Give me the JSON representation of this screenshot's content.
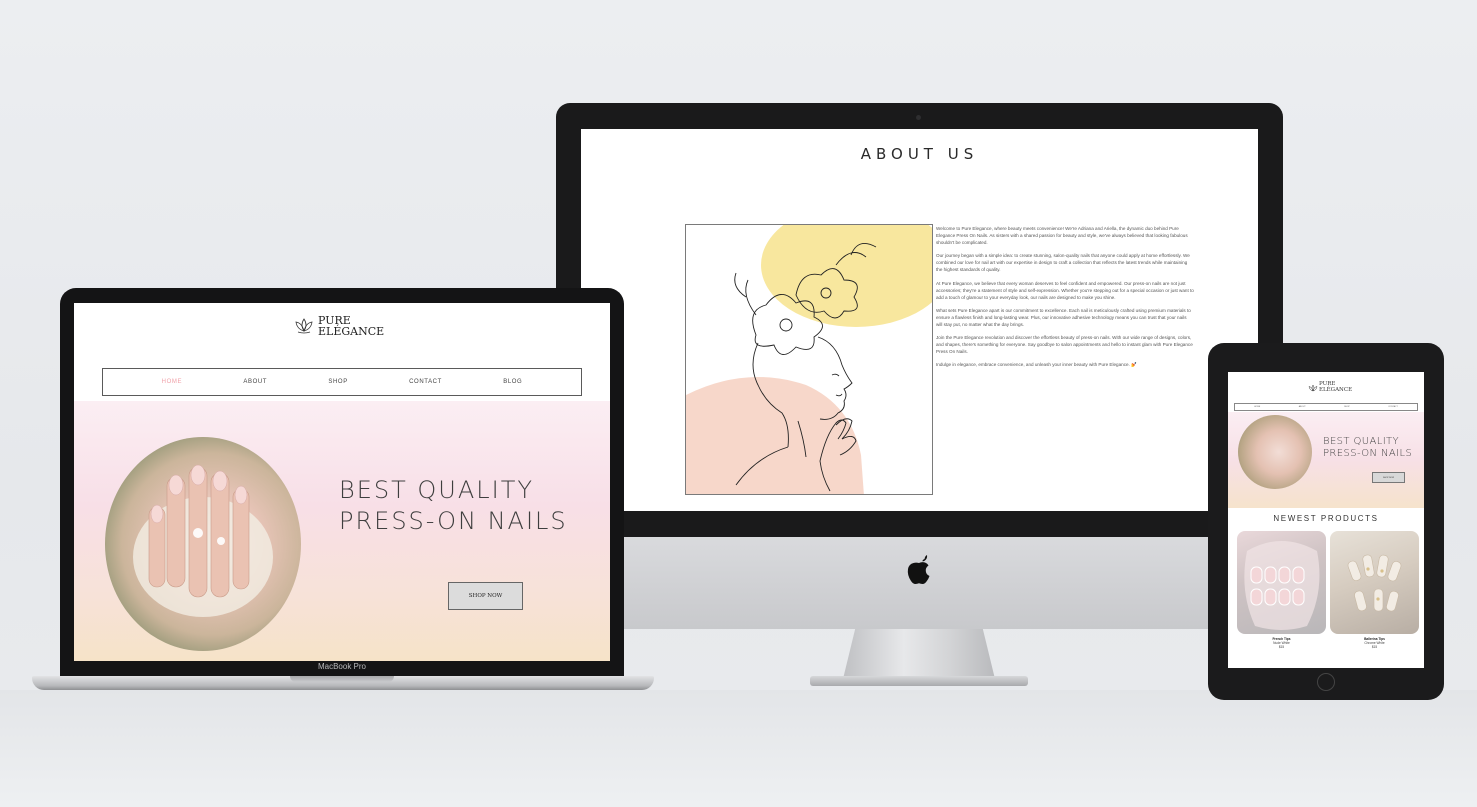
{
  "imac": {
    "about": {
      "title": "ABOUT US",
      "paragraphs": [
        "Welcome to Pure Elegance, where beauty meets convenience! We're Adriana and Ariella, the dynamic duo behind Pure Elegance Press On Nails. As sisters with a shared passion for beauty and style, we've always believed that looking fabulous shouldn't be complicated.",
        "Our journey began with a simple idea: to create stunning, salon-quality nails that anyone could apply at home effortlessly. We combined our love for nail art with our expertise in design to craft a collection that reflects the latest trends while maintaining the highest standards of quality.",
        "At Pure Elegance, we believe that every woman deserves to feel confident and empowered. Our press-on nails are not just accessories; they're a statement of style and self-expression. Whether you're stepping out for a special occasion or just want to add a touch of glamour to your everyday look, our nails are designed to make you shine.",
        "What sets Pure Elegance apart is our commitment to excellence. Each nail is meticulously crafted using premium materials to ensure a flawless finish and long-lasting wear. Plus, our innovative adhesive technology means you can trust that your nails will stay put, no matter what the day brings.",
        "Join the Pure Elegance revolution and discover the effortless beauty of press-on nails. With our wide range of designs, colors, and shapes, there's something for everyone. Say goodbye to salon appointments and hello to instant glam with Pure Elegance Press On Nails.",
        "Indulge in elegance, embrace convenience, and unleash your inner beauty with Pure Elegance. 💅"
      ]
    }
  },
  "macbook": {
    "device_label": "MacBook Pro",
    "brand": {
      "line1": "PURE",
      "line2": "ELÉGANCE"
    },
    "nav": [
      "HOME",
      "ABOUT",
      "SHOP",
      "CONTACT",
      "BLOG"
    ],
    "hero": {
      "line1": "BEST QUALITY",
      "line2": "PRESS-ON NAILS",
      "button": "SHOP NOW"
    }
  },
  "ipad": {
    "brand": {
      "line1": "PURE",
      "line2": "ELÉGANCE"
    },
    "nav": [
      "HOME",
      "ABOUT",
      "SHOP",
      "CONTACT"
    ],
    "hero": {
      "line1": "BEST QUALITY",
      "line2": "PRESS-ON NAILS",
      "button": "SHOP NOW"
    },
    "section_title": "NEWEST PRODUCTS",
    "products": [
      {
        "name": "French Tips",
        "variant": "Nude White",
        "price": "$15"
      },
      {
        "name": "Ballerina Tips",
        "variant": "Chrome White",
        "price": "$15"
      }
    ]
  },
  "colors": {
    "accent_pink": "#f0a0a8",
    "hero_pink": "#f8dfe7",
    "hero_peach": "#f6e3c8",
    "art_yellow": "#f6df7e",
    "art_peach": "#f4c9b8"
  }
}
